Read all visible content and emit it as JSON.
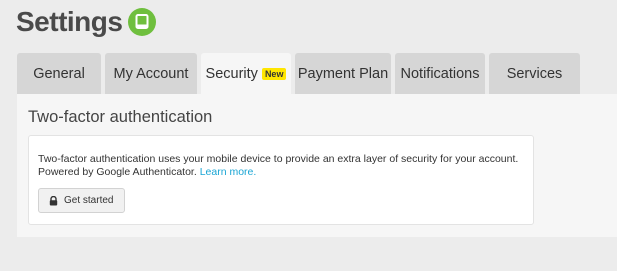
{
  "header": {
    "title": "Settings",
    "logo_icon": "evernote-logo-icon",
    "logo_color": "#6fbf3e"
  },
  "tabs": [
    {
      "label": "General",
      "active": false
    },
    {
      "label": "My Account",
      "active": false
    },
    {
      "label": "Security",
      "active": true,
      "badge": "New"
    },
    {
      "label": "Payment Plan",
      "active": false
    },
    {
      "label": "Notifications",
      "active": false
    },
    {
      "label": "Services",
      "active": false
    }
  ],
  "security": {
    "section_title": "Two-factor authentication",
    "description_line1": "Two-factor authentication uses your mobile device to provide an extra layer of security for your account.",
    "description_line2": "Powered by Google Authenticator.",
    "learn_more": "Learn more.",
    "button_label": "Get started",
    "button_icon": "lock-icon"
  },
  "colors": {
    "accent_link": "#1aa5d4",
    "badge": "#ffe600"
  }
}
